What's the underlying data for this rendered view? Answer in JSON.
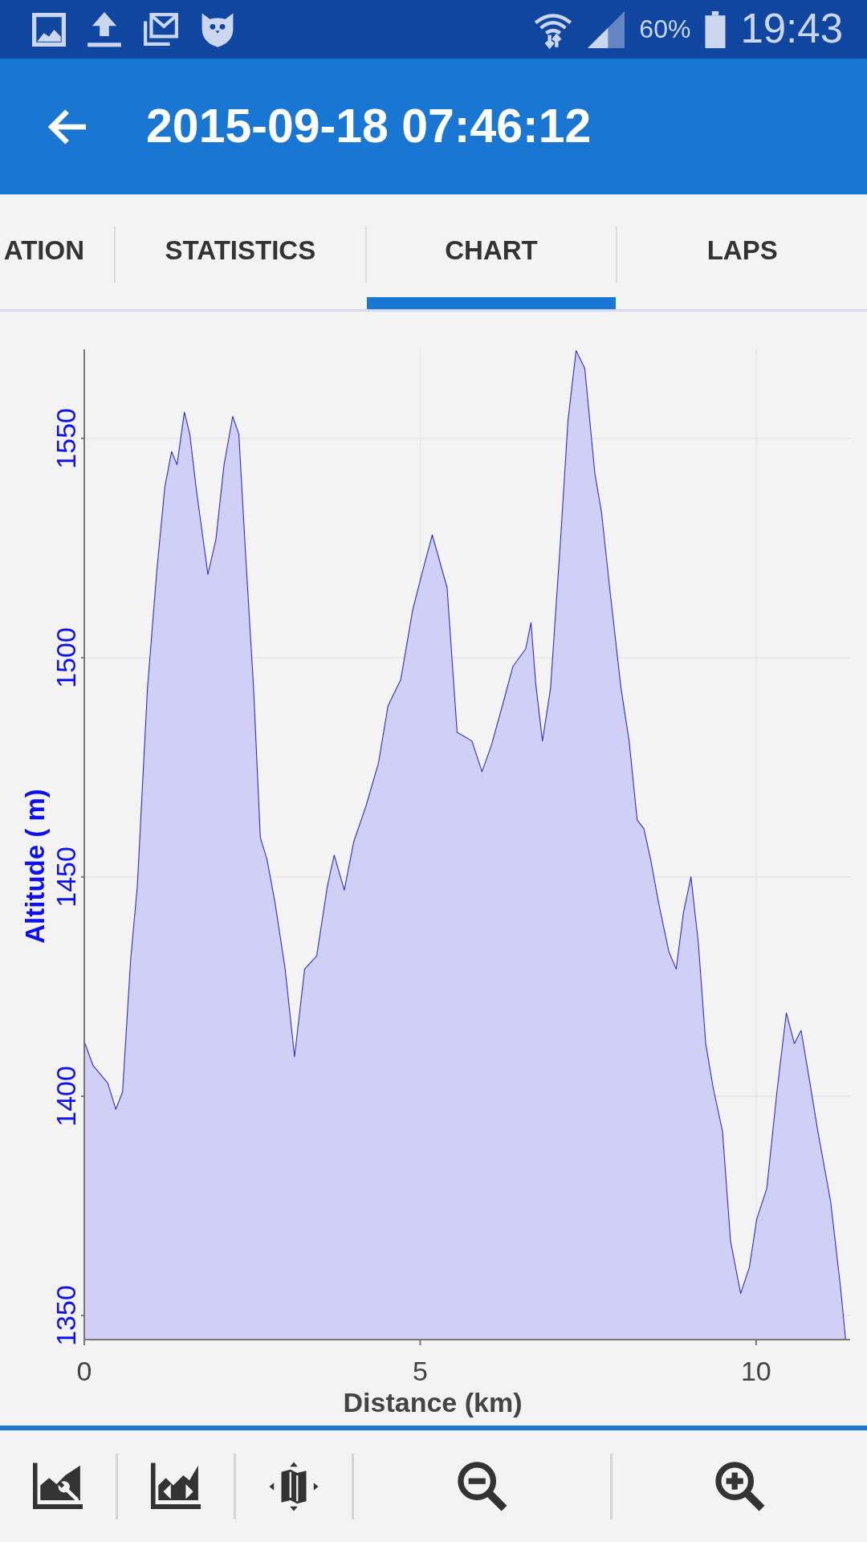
{
  "status_bar": {
    "battery": "60%",
    "time": "19:43"
  },
  "app_bar": {
    "title": "2015-09-18 07:46:12"
  },
  "tabs": [
    {
      "label": "ATION",
      "selected": false
    },
    {
      "label": "STATISTICS",
      "selected": false
    },
    {
      "label": "CHART",
      "selected": true
    },
    {
      "label": "LAPS",
      "selected": false
    }
  ],
  "chart": {
    "chart_data": {
      "type": "area",
      "xlabel": "Distance (km)",
      "ylabel": "Altitude ( m)",
      "x": [
        0,
        0.13,
        0.35,
        0.47,
        0.57,
        0.69,
        0.79,
        0.94,
        1.08,
        1.2,
        1.3,
        1.38,
        1.49,
        1.57,
        1.67,
        1.84,
        1.96,
        2.08,
        2.21,
        2.3,
        2.4,
        2.52,
        2.62,
        2.72,
        2.84,
        2.99,
        3.13,
        3.28,
        3.46,
        3.62,
        3.72,
        3.87,
        4.01,
        4.19,
        4.38,
        4.52,
        4.71,
        4.89,
        5.04,
        5.18,
        5.4,
        5.55,
        5.77,
        5.92,
        6.06,
        6.24,
        6.38,
        6.57,
        6.65,
        6.72,
        6.82,
        6.94,
        7.09,
        7.2,
        7.32,
        7.45,
        7.6,
        7.7,
        7.82,
        7.99,
        8.11,
        8.23,
        8.33,
        8.43,
        8.55,
        8.7,
        8.81,
        8.92,
        9.03,
        9.14,
        9.25,
        9.36,
        9.5,
        9.62,
        9.77,
        9.9,
        10.01,
        10.16,
        10.31,
        10.45,
        10.57,
        10.67,
        10.78,
        10.92,
        11.11,
        11.26,
        11.33
      ],
      "values": [
        1412.5,
        1407,
        1403,
        1397,
        1401,
        1431,
        1448,
        1493,
        1520,
        1539,
        1547,
        1544,
        1556,
        1551,
        1538,
        1519,
        1527,
        1544,
        1555,
        1551,
        1524,
        1493,
        1459,
        1454,
        1444,
        1429,
        1409,
        1429,
        1432,
        1448,
        1455,
        1447,
        1458,
        1466,
        1476,
        1489,
        1495,
        1511,
        1520,
        1528,
        1516,
        1483,
        1481,
        1474,
        1480,
        1490,
        1498,
        1502,
        1508,
        1494,
        1481,
        1493,
        1527,
        1554,
        1570,
        1566,
        1542,
        1533,
        1516,
        1493,
        1481,
        1463,
        1461,
        1454,
        1444,
        1433,
        1429,
        1442,
        1450,
        1435,
        1412,
        1402,
        1392,
        1367,
        1355,
        1361,
        1372,
        1379,
        1401,
        1419,
        1412,
        1415,
        1405,
        1392,
        1376,
        1356,
        1345
      ],
      "xlim": [
        0,
        11.4
      ],
      "ylim": [
        1344.5,
        1570.3
      ],
      "xticks": [
        0,
        5,
        10
      ],
      "yticks": [
        1350,
        1400,
        1450,
        1500,
        1550
      ],
      "grid": true
    }
  }
}
